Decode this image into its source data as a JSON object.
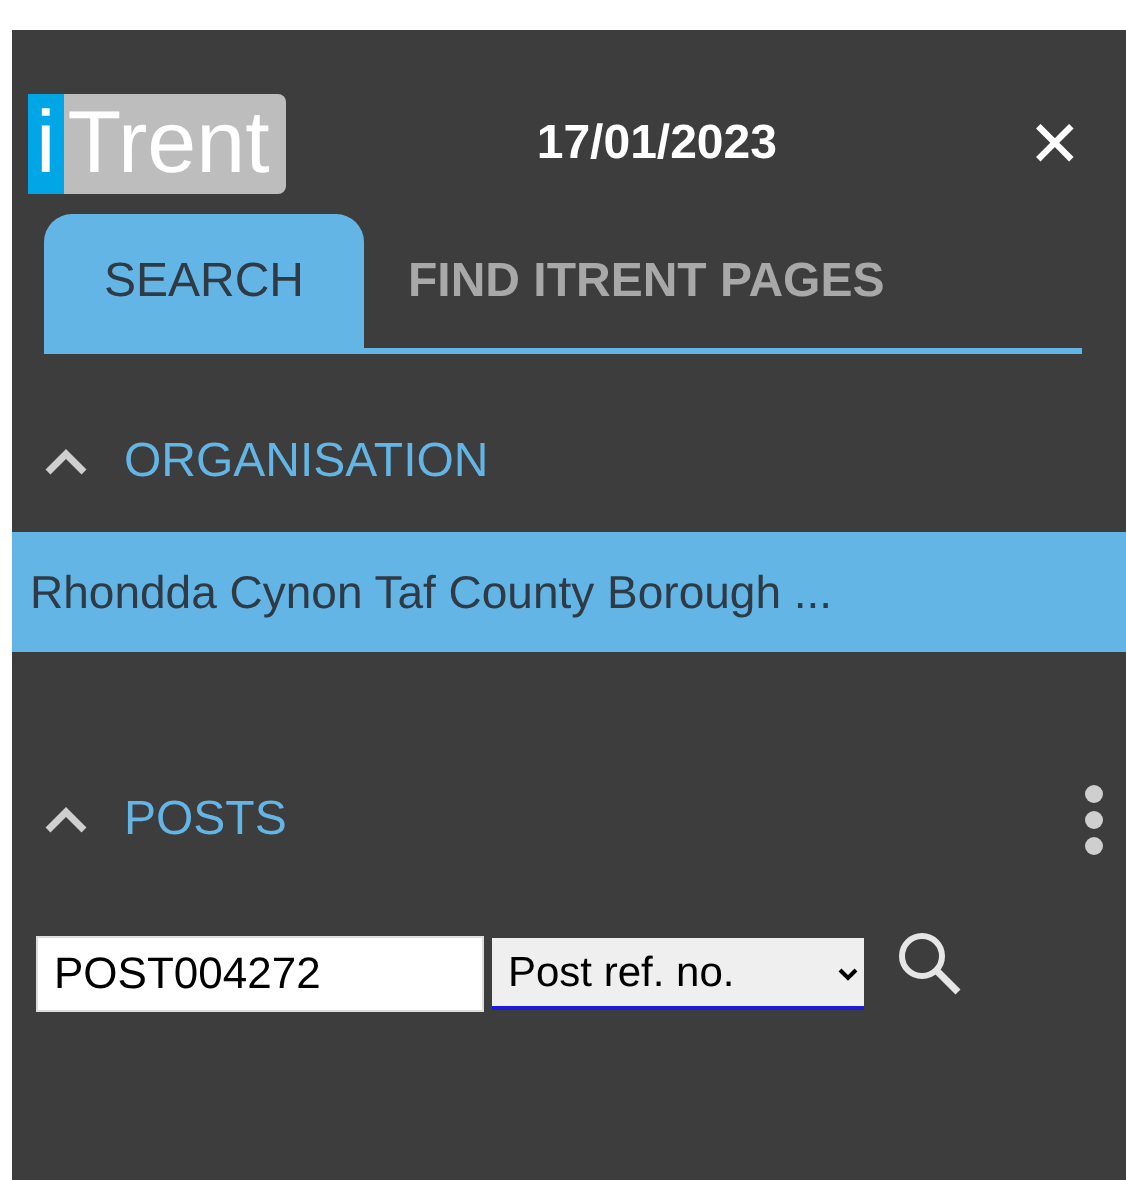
{
  "header": {
    "logo": {
      "prefix": "i",
      "name": "Trent"
    },
    "date": "17/01/2023",
    "close": "✕"
  },
  "tabs": [
    {
      "label": "SEARCH",
      "selected": true
    },
    {
      "label": "FIND ITRENT PAGES",
      "selected": false
    }
  ],
  "sections": [
    {
      "kind": "list",
      "title": "ORGANISATION",
      "expanded": true,
      "menu": false,
      "items": [
        {
          "label": "Rhondda Cynon Taf County Borough ...",
          "selected": true
        }
      ]
    },
    {
      "kind": "search",
      "title": "POSTS",
      "expanded": true,
      "menu": true,
      "search": {
        "value": "POST004272",
        "field": "Post ref. no."
      }
    }
  ]
}
